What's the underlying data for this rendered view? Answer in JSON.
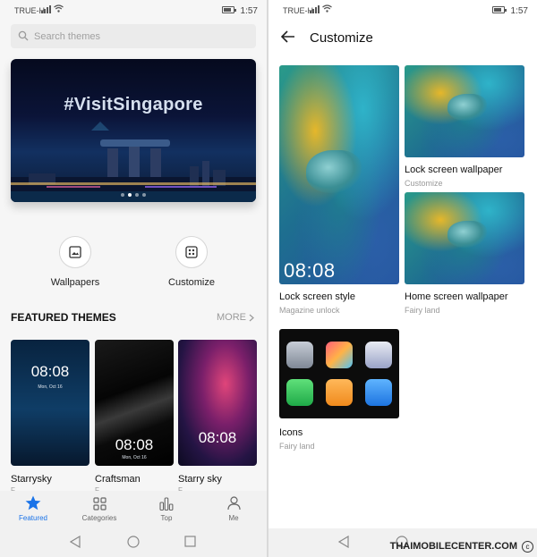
{
  "left": {
    "status": {
      "carrier": "TRUE-H",
      "time": "1:57"
    },
    "search": {
      "placeholder": "Search themes"
    },
    "banner": {
      "tag": "#VisitSingapore"
    },
    "quick_actions": [
      {
        "label": "Wallpapers",
        "icon": "image-icon"
      },
      {
        "label": "Customize",
        "icon": "grid-icon"
      }
    ],
    "featured": {
      "title": "FEATURED THEMES",
      "more_label": "MORE",
      "themes": [
        {
          "name": "Starrysky",
          "sub": "F...",
          "clock": "08:08",
          "date": "Mon, Oct 16"
        },
        {
          "name": "Craftsman",
          "sub": "F...",
          "clock": "08:08",
          "date": "Mon, Oct 16"
        },
        {
          "name": "Starry sky",
          "sub": "F...",
          "clock": "08:08",
          "date": ""
        }
      ]
    },
    "tabs": [
      {
        "label": "Featured",
        "icon": "star-icon",
        "active": true
      },
      {
        "label": "Categories",
        "icon": "categories-icon",
        "active": false
      },
      {
        "label": "Top",
        "icon": "bar-chart-icon",
        "active": false
      },
      {
        "label": "Me",
        "icon": "person-icon",
        "active": false
      }
    ]
  },
  "right": {
    "status": {
      "carrier": "TRUE-H",
      "time": "1:57"
    },
    "title": "Customize",
    "cards": [
      {
        "title": "Lock screen style",
        "subtitle": "Magazine unlock",
        "clock": "08:08"
      },
      {
        "title": "Lock screen wallpaper",
        "subtitle": "Customize"
      },
      {
        "title": "Home screen wallpaper",
        "subtitle": "Fairy land"
      },
      {
        "title": "Icons",
        "subtitle": "Fairy land"
      }
    ],
    "watermark": "THAIMOBILECENTER.COM"
  },
  "colors": {
    "accent": "#1a73e8"
  }
}
